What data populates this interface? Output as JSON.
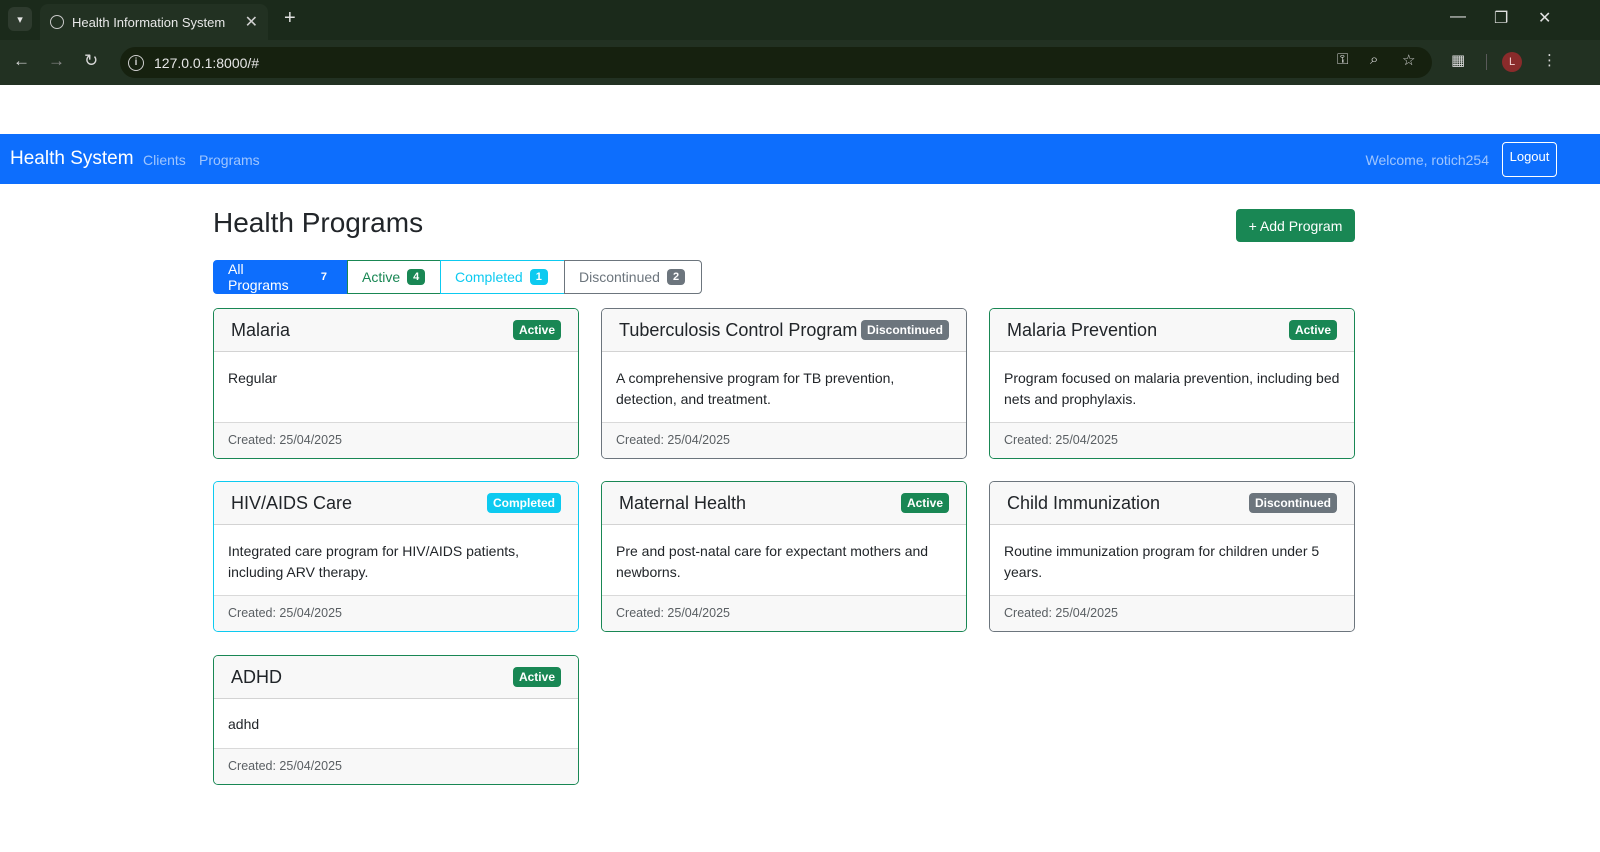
{
  "browser": {
    "tab_title": "Health Information System",
    "url": "127.0.0.1:8000/#",
    "profile_initial": "L"
  },
  "navbar": {
    "brand": "Health System",
    "links": [
      "Clients",
      "Programs"
    ],
    "welcome": "Welcome, rotich254",
    "logout_label": "Logout",
    "color": "#0d6efd"
  },
  "page": {
    "title": "Health Programs",
    "add_button_label": "+ Add Program"
  },
  "filters": [
    {
      "label": "All Programs",
      "count": "7"
    },
    {
      "label": "Active",
      "count": "4"
    },
    {
      "label": "Completed",
      "count": "1"
    },
    {
      "label": "Discontinued",
      "count": "2"
    }
  ],
  "programs": [
    {
      "name": "Malaria",
      "status": "Active",
      "description": "Regular",
      "created": "Created: 25/04/2025"
    },
    {
      "name": "Tuberculosis Control Program",
      "status": "Discontinued",
      "description": "A comprehensive program for TB prevention, detection, and treatment.",
      "created": "Created: 25/04/2025"
    },
    {
      "name": "Malaria Prevention",
      "status": "Active",
      "description": "Program focused on malaria prevention, including bed nets and prophylaxis.",
      "created": "Created: 25/04/2025"
    },
    {
      "name": "HIV/AIDS Care",
      "status": "Completed",
      "description": "Integrated care program for HIV/AIDS patients, including ARV therapy.",
      "created": "Created: 25/04/2025"
    },
    {
      "name": "Maternal Health",
      "status": "Active",
      "description": "Pre and post-natal care for expectant mothers and newborns.",
      "created": "Created: 25/04/2025"
    },
    {
      "name": "Child Immunization",
      "status": "Discontinued",
      "description": "Routine immunization program for children under 5 years.",
      "created": "Created: 25/04/2025"
    },
    {
      "name": "ADHD",
      "status": "Active",
      "description": "adhd",
      "created": "Created: 25/04/2025"
    }
  ],
  "status_colors": {
    "Active": "#198754",
    "Completed": "#0dcaf0",
    "Discontinued": "#6c757d"
  }
}
